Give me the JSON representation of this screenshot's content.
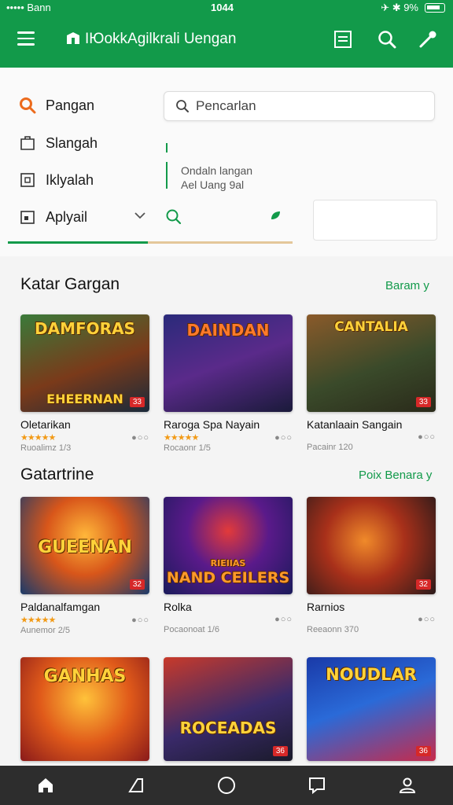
{
  "status": {
    "carrier": "••••• Bann",
    "time": "1044",
    "right_text": "✈ ✱ 9%"
  },
  "app": {
    "title": "IЮokkAgilkrali Uengan"
  },
  "filters": {
    "categories": [
      {
        "label": "Pangan",
        "icon": "search-icon"
      },
      {
        "label": "Slangah",
        "icon": "bag-icon"
      },
      {
        "label": "Iklyalah",
        "icon": "image-icon"
      },
      {
        "label": "Aplyail",
        "icon": "app-icon"
      }
    ],
    "search_placeholder": "Pencarlan",
    "note_line1": "Ondaln langan",
    "note_line2": "Ael Uang 9al"
  },
  "sections": [
    {
      "title": "Katar Gargan",
      "see_all": "Baram y",
      "items": [
        {
          "name": "Oletarikan",
          "sub": "Ruoalimz   1/3",
          "art": "DAMFORAS",
          "art2": "EHEERNAN",
          "badge": "33"
        },
        {
          "name": "Raroga Spa Nayain",
          "sub": "Rocaonr   1/5",
          "art": "DAINDAN",
          "art2": "",
          "badge": ""
        },
        {
          "name": "Katanlaain Sangain",
          "sub": "Pacainr   120",
          "art": "CANTALIA",
          "art2": "",
          "badge": "33"
        }
      ]
    },
    {
      "title": "Gatartrine",
      "see_all": "Poix Benara y",
      "items": [
        {
          "name": "Paldanalfamgan",
          "sub": "Aunemor   2/5",
          "art": "GUEENAN",
          "art2": "",
          "badge": "32"
        },
        {
          "name": "Rolka",
          "sub": "Pocaonoat   1/6",
          "art": "NAND CEILERS",
          "art2": "RIEIIAS",
          "badge": ""
        },
        {
          "name": "Rarnios",
          "sub": "Reeaonn   370",
          "art": "",
          "art2": "",
          "badge": "32"
        }
      ]
    },
    {
      "items": [
        {
          "art": "GANHAS",
          "badge": ""
        },
        {
          "art": "ROCEADAS",
          "badge": "36"
        },
        {
          "art": "NOUDLAR",
          "badge": "36"
        }
      ]
    }
  ],
  "ratings": [
    "★★★★★",
    "★★★★★",
    "",
    "★★★★★",
    "",
    ""
  ],
  "colors": {
    "brand": "#129a4a",
    "nav_bg": "#2d2d2d"
  }
}
